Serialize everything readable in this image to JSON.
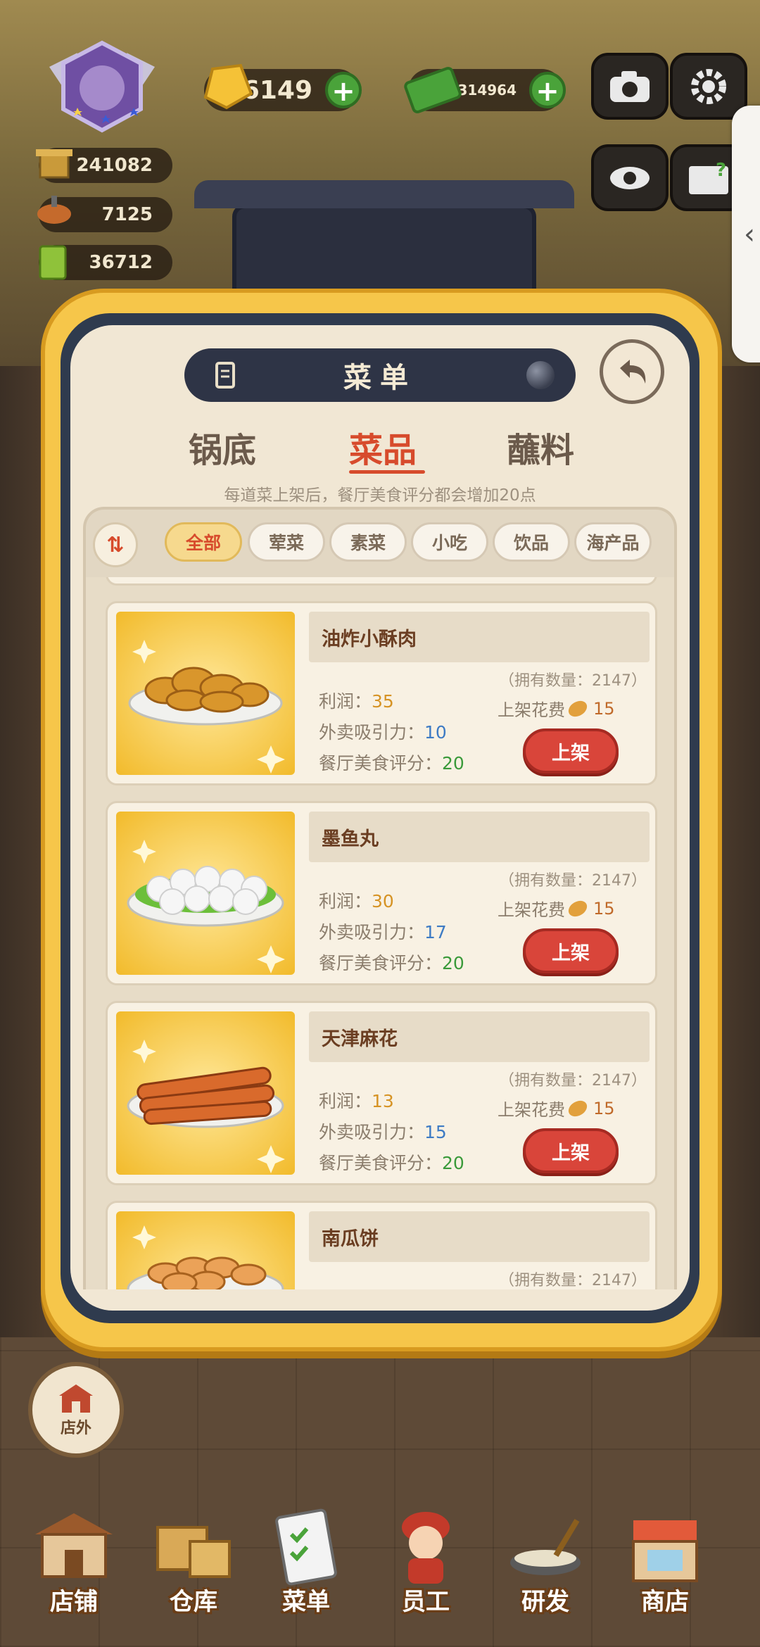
{
  "hud": {
    "gold": "86149",
    "cash": "1625314964",
    "stat_1": "241082",
    "stat_2": "7125",
    "stat_3": "36712"
  },
  "menu": {
    "title": "菜单",
    "tabs": [
      "锅底",
      "菜品",
      "蘸料"
    ],
    "active_tab": "菜品",
    "hint": "每道菜上架后，餐厅美食评分都会增加20点",
    "filters": [
      "全部",
      "荤菜",
      "素菜",
      "小吃",
      "饮品",
      "海产品"
    ],
    "active_filter": "全部"
  },
  "labels": {
    "profit": "利润：",
    "delivery": "外卖吸引力：",
    "rating": "餐厅美食评分：",
    "cost": "上架花费",
    "shelf_button": "上架"
  },
  "dishes": [
    {
      "name": "油炸小酥肉",
      "profit": "35",
      "delivery": "10",
      "rating": "20",
      "owned": "（拥有数量：2147）",
      "cost": "15"
    },
    {
      "name": "墨鱼丸",
      "profit": "30",
      "delivery": "17",
      "rating": "20",
      "owned": "（拥有数量：2147）",
      "cost": "15"
    },
    {
      "name": "天津麻花",
      "profit": "13",
      "delivery": "15",
      "rating": "20",
      "owned": "（拥有数量：2147）",
      "cost": "15"
    },
    {
      "name": "南瓜饼",
      "owned": "（拥有数量：2147）"
    }
  ],
  "outside_button": "店外",
  "bottom_nav": [
    "店铺",
    "仓库",
    "菜单",
    "员工",
    "研发",
    "商店"
  ],
  "colors": {
    "accent_red": "#d74b2c",
    "modal_gold": "#f6c64a",
    "profit": "#d69324",
    "delivery": "#3e7bc4",
    "rating": "#3a9a3a"
  }
}
